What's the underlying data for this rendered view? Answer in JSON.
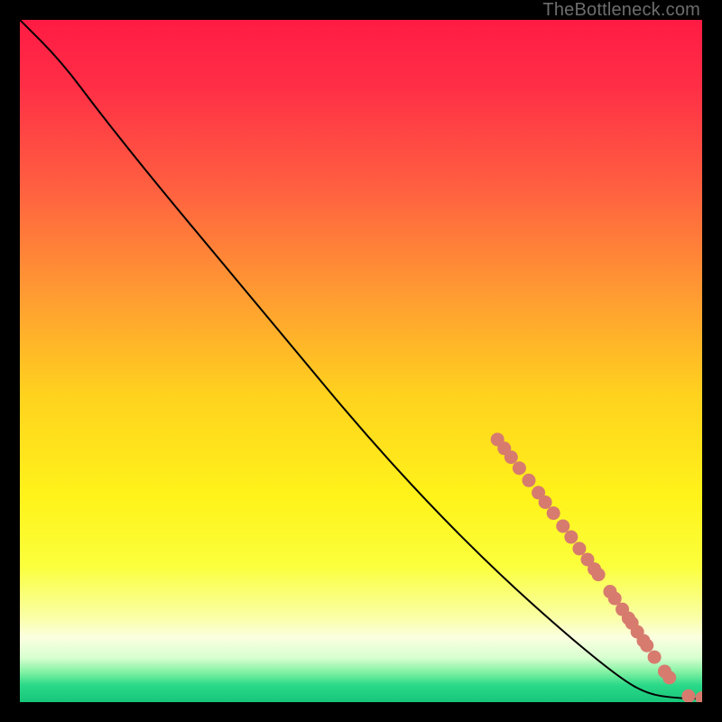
{
  "watermark": "TheBottleneck.com",
  "chart_data": {
    "type": "line",
    "title": "",
    "xlabel": "",
    "ylabel": "",
    "xlim": [
      0,
      100
    ],
    "ylim": [
      0,
      100
    ],
    "curve": [
      {
        "x": 0,
        "y": 100
      },
      {
        "x": 6,
        "y": 94
      },
      {
        "x": 12,
        "y": 86
      },
      {
        "x": 20,
        "y": 76
      },
      {
        "x": 30,
        "y": 64
      },
      {
        "x": 40,
        "y": 52
      },
      {
        "x": 50,
        "y": 40
      },
      {
        "x": 60,
        "y": 29
      },
      {
        "x": 70,
        "y": 19
      },
      {
        "x": 80,
        "y": 10
      },
      {
        "x": 88,
        "y": 3.5
      },
      {
        "x": 92,
        "y": 1.2
      },
      {
        "x": 96,
        "y": 0.6
      },
      {
        "x": 100,
        "y": 0.5
      }
    ],
    "markers": [
      {
        "x": 70.0,
        "y": 38.5
      },
      {
        "x": 71.0,
        "y": 37.2
      },
      {
        "x": 72.0,
        "y": 35.9
      },
      {
        "x": 73.2,
        "y": 34.3
      },
      {
        "x": 74.6,
        "y": 32.5
      },
      {
        "x": 76.0,
        "y": 30.7
      },
      {
        "x": 77.0,
        "y": 29.3
      },
      {
        "x": 78.2,
        "y": 27.7
      },
      {
        "x": 79.6,
        "y": 25.8
      },
      {
        "x": 80.8,
        "y": 24.2
      },
      {
        "x": 82.0,
        "y": 22.5
      },
      {
        "x": 83.2,
        "y": 20.9
      },
      {
        "x": 84.2,
        "y": 19.5
      },
      {
        "x": 84.8,
        "y": 18.7
      },
      {
        "x": 86.5,
        "y": 16.2
      },
      {
        "x": 87.2,
        "y": 15.2
      },
      {
        "x": 88.3,
        "y": 13.6
      },
      {
        "x": 89.2,
        "y": 12.3
      },
      {
        "x": 89.7,
        "y": 11.6
      },
      {
        "x": 90.5,
        "y": 10.3
      },
      {
        "x": 91.4,
        "y": 9.0
      },
      {
        "x": 91.9,
        "y": 8.3
      },
      {
        "x": 93.0,
        "y": 6.6
      },
      {
        "x": 94.5,
        "y": 4.5
      },
      {
        "x": 95.2,
        "y": 3.6
      },
      {
        "x": 98.0,
        "y": 0.9
      },
      {
        "x": 100.0,
        "y": 0.6
      },
      {
        "x": 100.6,
        "y": 0.6
      }
    ],
    "marker_color": "#d77b6f",
    "curve_color": "#000000",
    "gradient_stops": [
      {
        "offset": 0.0,
        "color": "#ff1b44"
      },
      {
        "offset": 0.1,
        "color": "#ff2f46"
      },
      {
        "offset": 0.25,
        "color": "#ff6140"
      },
      {
        "offset": 0.4,
        "color": "#ff9a32"
      },
      {
        "offset": 0.55,
        "color": "#ffd21e"
      },
      {
        "offset": 0.7,
        "color": "#fff31a"
      },
      {
        "offset": 0.8,
        "color": "#fbff3c"
      },
      {
        "offset": 0.875,
        "color": "#faffa5"
      },
      {
        "offset": 0.905,
        "color": "#fbffe0"
      },
      {
        "offset": 0.935,
        "color": "#d8ffd0"
      },
      {
        "offset": 0.955,
        "color": "#86f2a4"
      },
      {
        "offset": 0.975,
        "color": "#2bd989"
      },
      {
        "offset": 1.0,
        "color": "#17c57a"
      }
    ]
  }
}
